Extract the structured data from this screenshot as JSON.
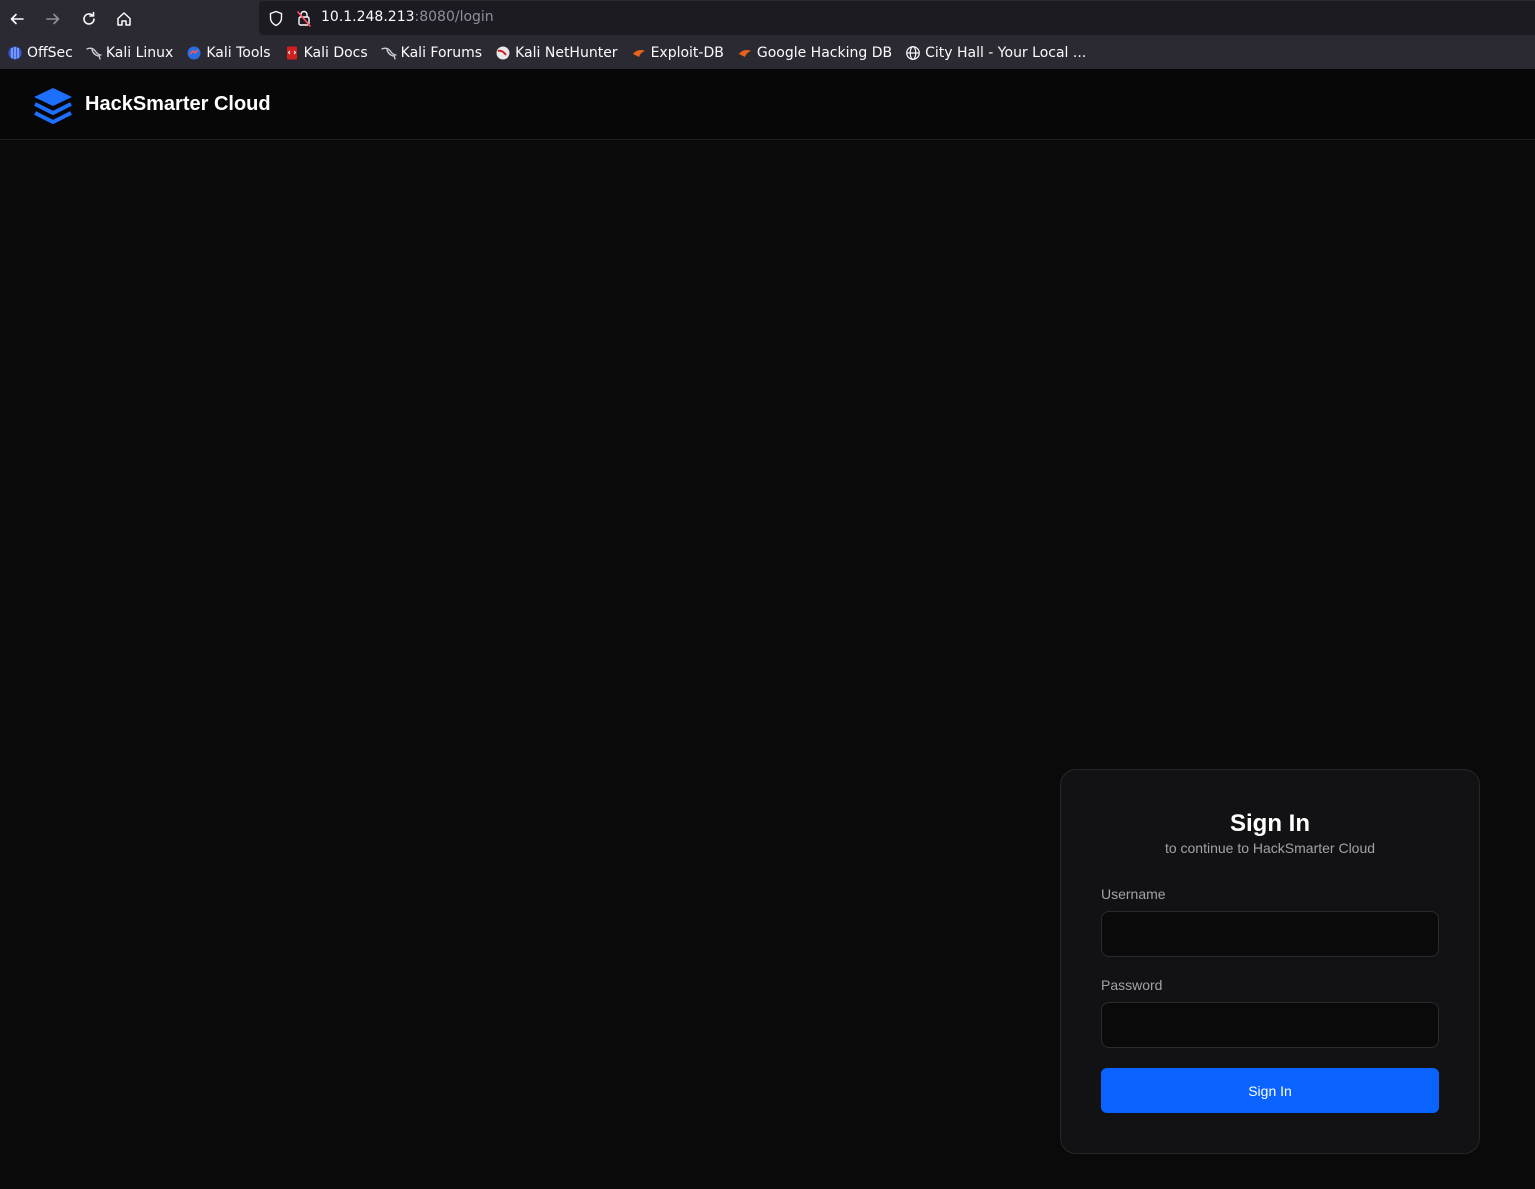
{
  "browser": {
    "url_host": "10.1.248.213",
    "url_path": ":8080/login",
    "bookmarks": [
      {
        "label": "OffSec",
        "icon": "offsec-icon"
      },
      {
        "label": "Kali Linux",
        "icon": "kali-dragon-icon"
      },
      {
        "label": "Kali Tools",
        "icon": "kali-tools-icon"
      },
      {
        "label": "Kali Docs",
        "icon": "kali-docs-icon"
      },
      {
        "label": "Kali Forums",
        "icon": "kali-dragon-icon"
      },
      {
        "label": "Kali NetHunter",
        "icon": "nethunter-icon"
      },
      {
        "label": "Exploit-DB",
        "icon": "exploit-db-icon"
      },
      {
        "label": "Google Hacking DB",
        "icon": "exploit-db-icon"
      },
      {
        "label": "City Hall - Your Local ...",
        "icon": "globe-icon"
      }
    ]
  },
  "header": {
    "brand": "HackSmarter Cloud",
    "logo_icon": "stacked-layers-icon"
  },
  "login": {
    "title": "Sign In",
    "subtitle": "to continue to HackSmarter Cloud",
    "username_label": "Username",
    "username_value": "",
    "password_label": "Password",
    "password_value": "",
    "submit_label": "Sign In"
  },
  "colors": {
    "accent": "#0a63ff",
    "background": "#0a0a0b",
    "card": "#121214"
  }
}
